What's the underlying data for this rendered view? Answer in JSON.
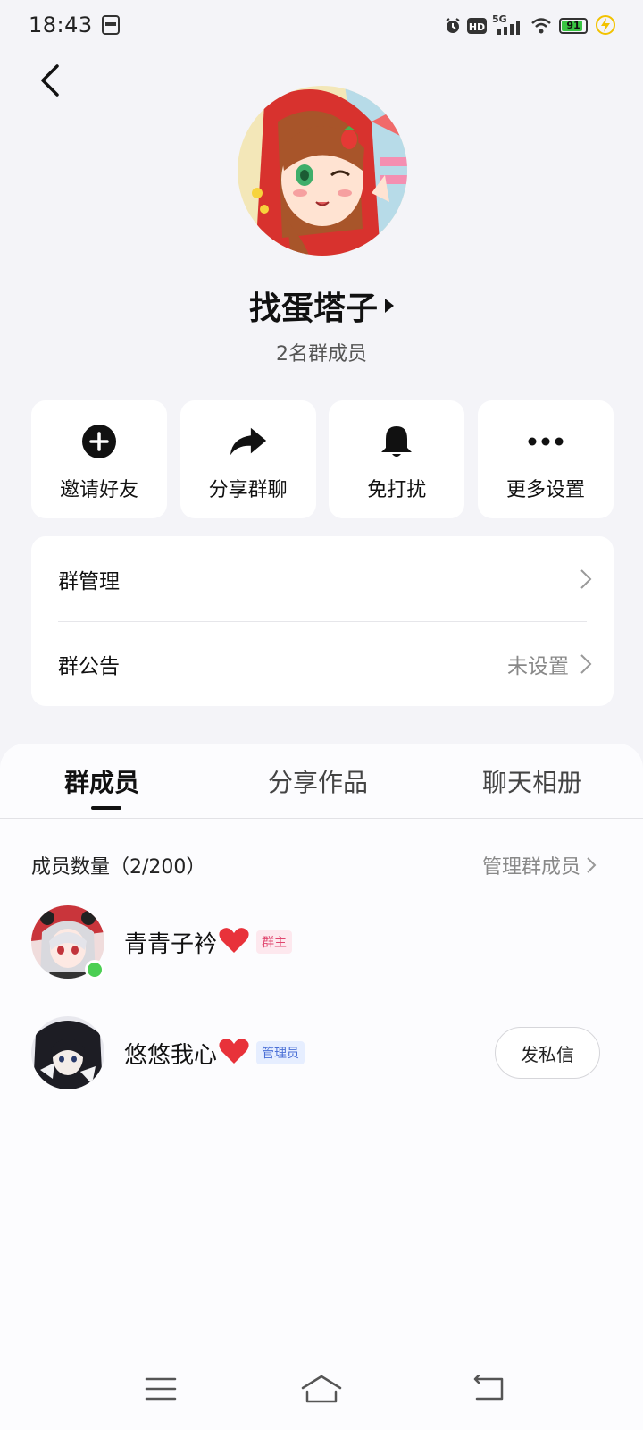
{
  "status_bar": {
    "time": "18:43",
    "network": "5G",
    "hd": "HD",
    "battery": "91",
    "battery_level": 0.91
  },
  "group": {
    "name": "找蛋塔子",
    "member_caption": "2名群成员"
  },
  "actions": [
    {
      "label": "邀请好友",
      "icon": "plus-circle-icon"
    },
    {
      "label": "分享群聊",
      "icon": "share-arrow-icon"
    },
    {
      "label": "免打扰",
      "icon": "bell-icon"
    },
    {
      "label": "更多设置",
      "icon": "more-dots-icon"
    }
  ],
  "settings": {
    "manage_label": "群管理",
    "notice_label": "群公告",
    "notice_value": "未设置"
  },
  "tabs": [
    "群成员",
    "分享作品",
    "聊天相册"
  ],
  "members_section": {
    "count_label": "成员数量（2/200）",
    "manage_link": "管理群成员"
  },
  "members": [
    {
      "name": "青青子衿",
      "role": "群主",
      "online": true
    },
    {
      "name": "悠悠我心",
      "role": "管理员",
      "action": "发私信"
    }
  ],
  "colors": {
    "background": "#f4f4f8",
    "online": "#4ccf53",
    "heart": "#e8323a",
    "owner_badge": "#e0466e",
    "admin_badge": "#4a6fd6"
  }
}
